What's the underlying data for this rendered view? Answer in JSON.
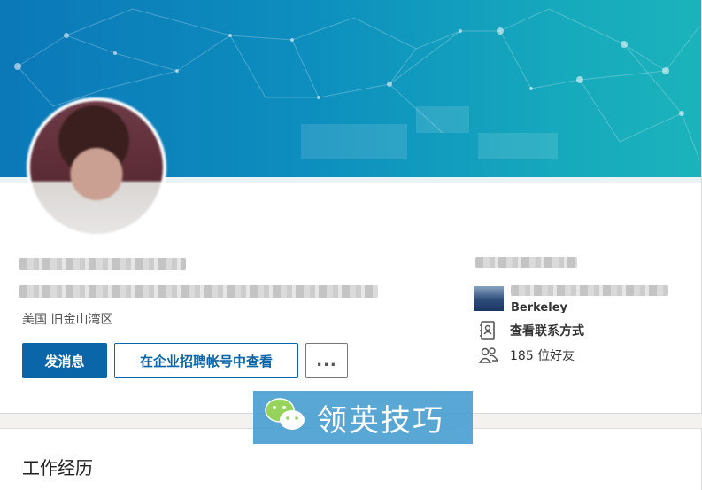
{
  "profile": {
    "location": "美国 旧金山湾区",
    "school_partial": "Berkeley"
  },
  "actions": {
    "message_label": "发消息",
    "recruiter_label": "在企业招聘帐号中查看",
    "more_label": "..."
  },
  "sidebar": {
    "contact_label": "查看联系方式",
    "connections_label": "185 位好友"
  },
  "watermark": {
    "text": "领英技巧"
  },
  "sections": {
    "experience_title": "工作经历"
  },
  "colors": {
    "primary": "#0a66a8",
    "cover_start": "#0b78b8",
    "cover_end": "#1bb3bb",
    "watermark_bg": "#4aa0d2"
  },
  "icons": {
    "contact": "address-book-icon",
    "connections": "people-icon",
    "wechat": "wechat-icon"
  }
}
